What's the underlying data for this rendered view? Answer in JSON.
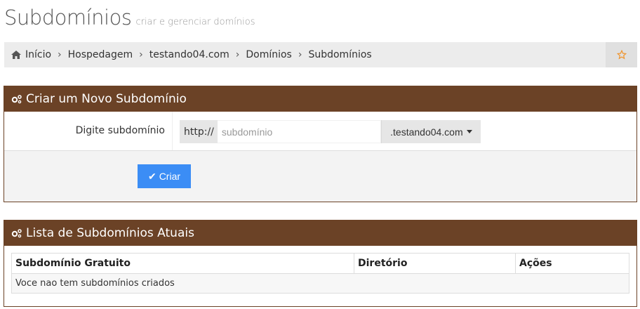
{
  "header": {
    "title": "Subdomínios",
    "subtitle": "criar e gerenciar domínios"
  },
  "breadcrumb": {
    "items": [
      "Início",
      "Hospedagem",
      "testando04.com",
      "Domínios",
      "Subdomínios"
    ],
    "home_icon": "home-icon",
    "star_icon": "star-icon",
    "star_color": "#f0932b"
  },
  "create_panel": {
    "title": "Criar um Novo Subdomínio",
    "icon": "cogs-icon",
    "label": "Digite subdomínio",
    "prefix": "http://",
    "input_value": "",
    "input_placeholder": "subdomínio",
    "domain_selected": ".testando04.com",
    "submit_label": "Criar",
    "submit_icon": "check-icon",
    "submit_color": "#3b8df5"
  },
  "list_panel": {
    "title": "Lista de Subdomínios Atuais",
    "icon": "cogs-icon",
    "columns": [
      "Subdomínio Gratuito",
      "Diretório",
      "Ações"
    ],
    "empty_message": "Voce nao tem subdomínios criados"
  },
  "colors": {
    "panel_header": "#6b4226",
    "breadcrumb_bg": "#ececec"
  }
}
